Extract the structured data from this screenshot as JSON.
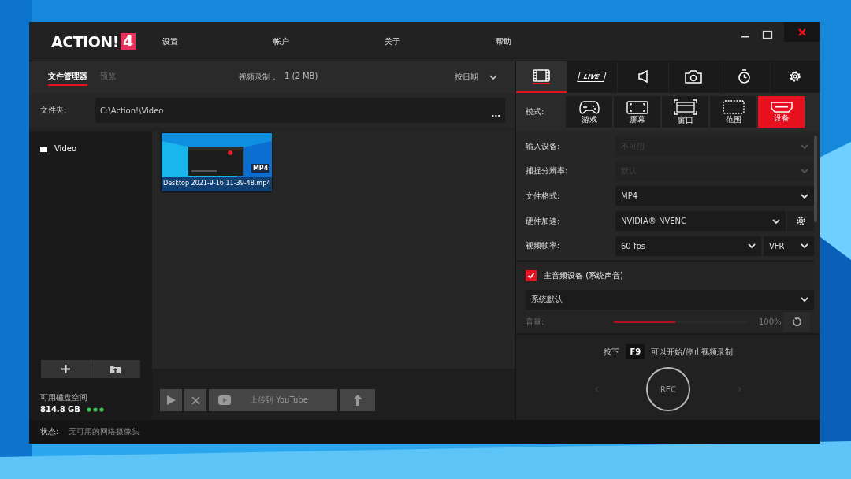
{
  "window": {
    "logo_text": "ACTION!",
    "logo_badge": "4",
    "menu": [
      "设置",
      "帐户",
      "关于",
      "帮助"
    ]
  },
  "file_manager": {
    "tabs": [
      {
        "label": "文件管理器",
        "selected": true,
        "disabled": false
      },
      {
        "label": "预览",
        "selected": false,
        "disabled": true
      }
    ],
    "recording_label": "视频录制：",
    "recording_value": "1 (2 MB)",
    "sort": "按日期",
    "folder_label": "文件夹:",
    "folder_path": "C:\\Action!\\Video",
    "folder_more": "...",
    "tree": [
      {
        "label": "Video",
        "selected": false
      }
    ],
    "files": [
      {
        "name": "Desktop 2021-9-16 11-39-48.mp4",
        "badge": "MP4",
        "selected": true
      }
    ],
    "disk_label": "可用磁盘空间",
    "disk_value": "814.8 GB",
    "actions": {
      "disabled": true,
      "upload_label": "上传到 YouTube"
    }
  },
  "record_tabs": [
    {
      "selected": true
    },
    {
      "label": "LIVE",
      "selected": false
    },
    {
      "selected": false
    },
    {
      "selected": false
    },
    {
      "selected": false
    },
    {
      "selected": false
    }
  ],
  "mode_label": "模式:",
  "modes": [
    {
      "label": "游戏",
      "selected": false
    },
    {
      "label": "屏幕",
      "selected": false
    },
    {
      "label": "窗口",
      "selected": false
    },
    {
      "label": "范围",
      "selected": false
    },
    {
      "label": "设备",
      "selected": true
    }
  ],
  "settings": [
    {
      "kind": "select",
      "label": "输入设备:",
      "value": "不可用",
      "disabled": true
    },
    {
      "kind": "select",
      "label": "捕捉分辨率:",
      "value": "默认",
      "disabled": true
    },
    {
      "kind": "select",
      "label": "文件格式:",
      "value": "MP4",
      "disabled": false
    },
    {
      "kind": "select_gear",
      "label": "硬件加速:",
      "value": "NVIDIA® NVENC",
      "disabled": false
    },
    {
      "kind": "select_pair",
      "label": "视频帧率:",
      "value": "60 fps",
      "value2": "VFR",
      "disabled": false
    }
  ],
  "audio": {
    "checked": true,
    "label": "主音频设备 (系统声音)",
    "device": "系统默认",
    "volume_label": "音量:",
    "level": 0.46,
    "reading": "100%",
    "disabled": true
  },
  "hint": {
    "before": "按下",
    "key": "F9",
    "after": "可以开始/停止视频录制"
  },
  "rec_label": "REC",
  "status_bar": {
    "label": "状态:",
    "value": "无可用的网络摄像头"
  }
}
